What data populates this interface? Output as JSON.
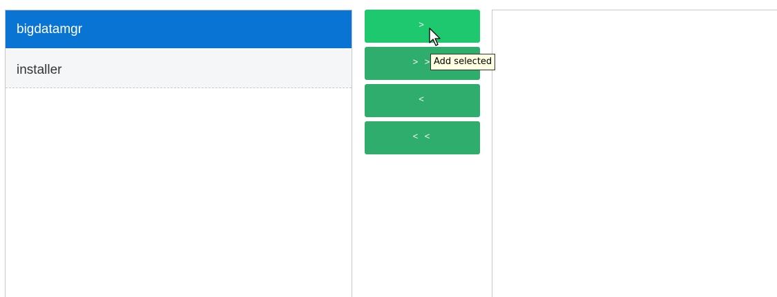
{
  "available_list": {
    "items": [
      {
        "label": "bigdatamgr",
        "selected": true
      },
      {
        "label": "installer",
        "selected": false
      }
    ]
  },
  "buttons": {
    "add_selected": ">",
    "add_all": "> >",
    "remove_selected": "<",
    "remove_all": "< <"
  },
  "tooltip": {
    "text": "Add selected"
  },
  "colors": {
    "selected_item": "#0a74d4",
    "button": "#2fad6c",
    "button_hover": "#1dc86e"
  }
}
